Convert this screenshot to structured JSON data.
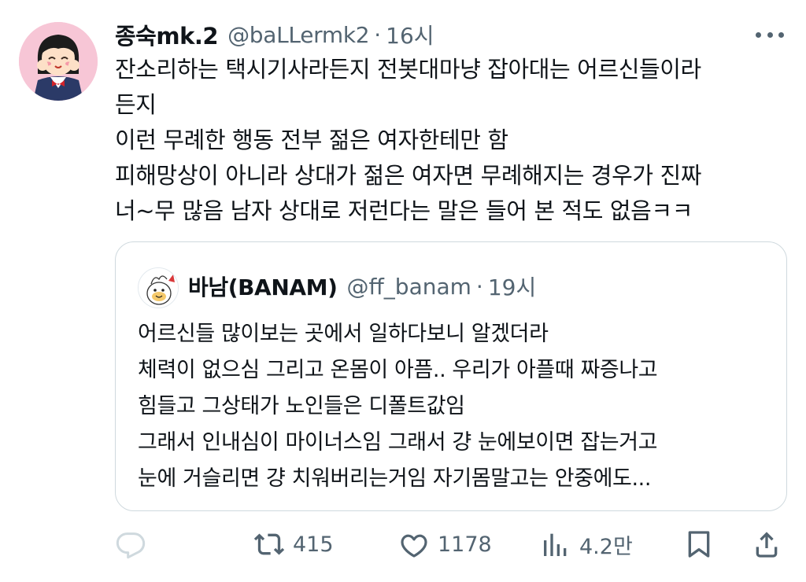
{
  "tweet": {
    "display_name": "종숙mk.2",
    "handle": "@baLLermk2",
    "separator": "·",
    "time": "16시",
    "lines": [
      "잔소리하는 택시기사라든지 전봇대마냥 잡아대는 어르신들이라",
      "든지",
      "이런 무례한 행동 전부 젊은 여자한테만 함",
      "피해망상이 아니라 상대가 젊은 여자면 무례해지는 경우가 진짜",
      "너~무 많음 남자 상대로 저런다는 말은 들어 본 적도 없음ㅋㅋ"
    ]
  },
  "quote": {
    "display_name": "바남(BANAM)",
    "handle": "@ff_banam",
    "separator": "·",
    "time": "19시",
    "lines": [
      "어르신들 많이보는 곳에서 일하다보니 알겠더라",
      "체력이 없으심 그리고 온몸이 아픔.. 우리가 아플때 짜증나고",
      "힘들고 그상태가 노인들은 디폴트값임",
      "그래서 인내심이 마이너스임 그래서 걍 눈에보이면 잡는거고",
      "눈에 거슬리면 걍 치워버리는거임 자기몸말고는 안중에도..."
    ]
  },
  "actions": {
    "reply_icon": "reply-icon",
    "retweet_icon": "retweet-icon",
    "retweet_count": "415",
    "like_icon": "heart-icon",
    "like_count": "1178",
    "views_icon": "views-icon",
    "views_count": "4.2만",
    "bookmark_icon": "bookmark-icon",
    "share_icon": "share-icon"
  },
  "colors": {
    "text_primary": "#0f1419",
    "text_secondary": "#536471",
    "border": "#cfd9de",
    "reply_icon_faded": "#cfd9de",
    "avatar_bg": "#f7c6d6"
  }
}
